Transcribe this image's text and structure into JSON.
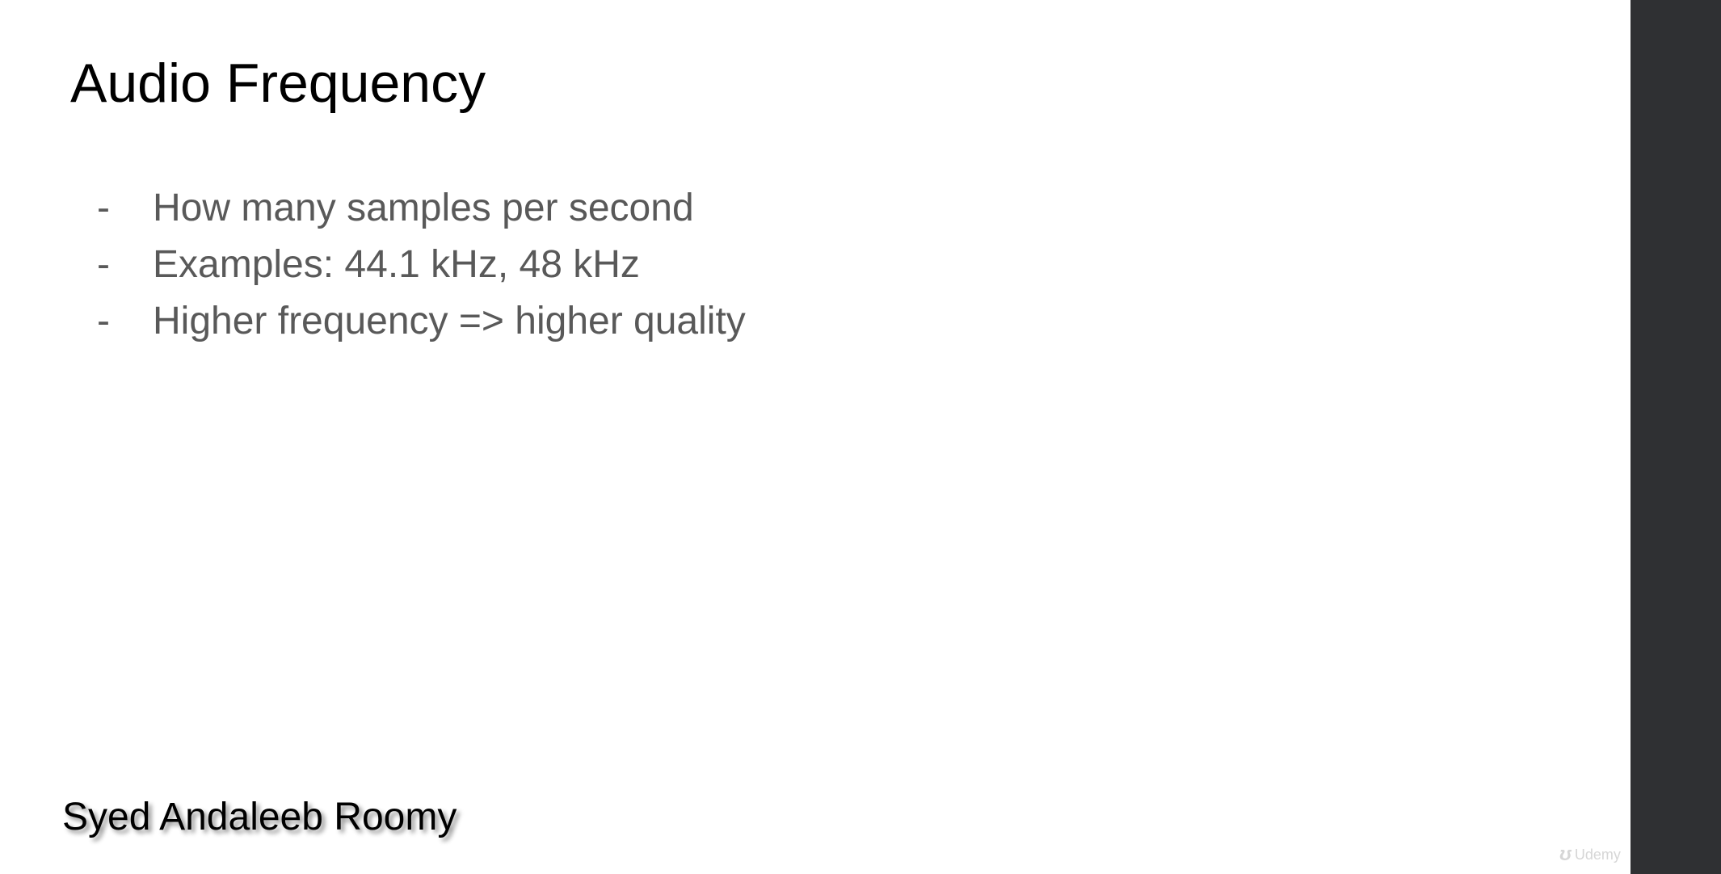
{
  "slide": {
    "title": "Audio Frequency",
    "bullets": [
      {
        "marker": "-",
        "text": "How many samples per second"
      },
      {
        "marker": "-",
        "text": "Examples: 44.1 kHz, 48 kHz"
      },
      {
        "marker": "-",
        "text": "Higher frequency => higher quality"
      }
    ],
    "author": "Syed Andaleeb Roomy"
  },
  "watermark": {
    "icon": "udemy-logo-icon",
    "text": "Udemy"
  },
  "colors": {
    "background": "#ffffff",
    "title": "#000000",
    "bullet_text": "#595959",
    "side_bar": "#2f3033"
  }
}
